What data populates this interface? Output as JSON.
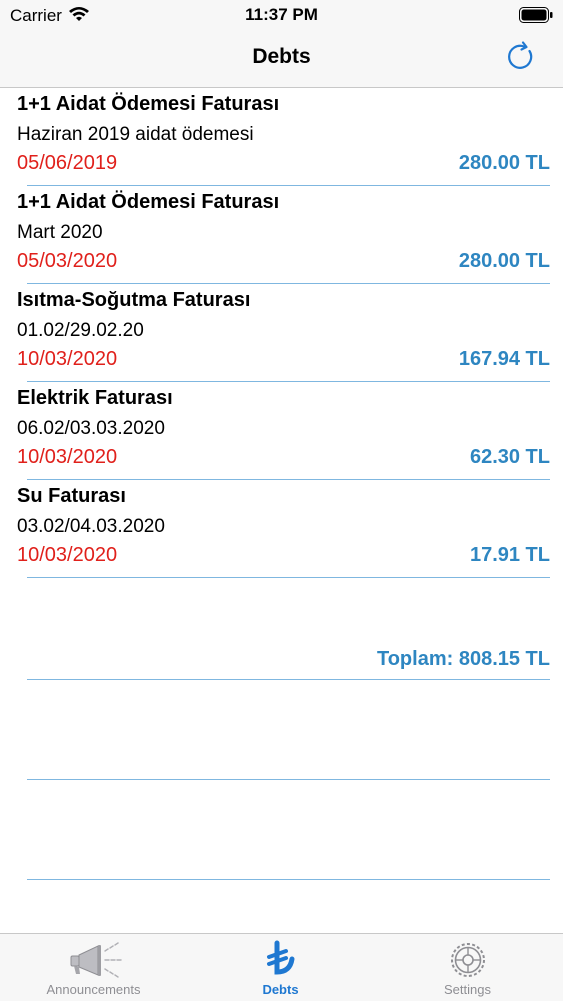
{
  "status_bar": {
    "carrier": "Carrier",
    "time": "11:37 PM"
  },
  "nav": {
    "title": "Debts",
    "refresh_icon": "refresh-icon"
  },
  "debts": [
    {
      "title": "1+1 Aidat Ödemesi Faturası",
      "subtitle": "Haziran 2019 aidat ödemesi",
      "date": "05/06/2019",
      "amount": "280.00 TL"
    },
    {
      "title": "1+1 Aidat Ödemesi Faturası",
      "subtitle": "Mart 2020",
      "date": "05/03/2020",
      "amount": "280.00 TL"
    },
    {
      "title": "Isıtma-Soğutma Faturası",
      "subtitle": "01.02/29.02.20",
      "date": "10/03/2020",
      "amount": "167.94 TL"
    },
    {
      "title": "Elektrik Faturası",
      "subtitle": "06.02/03.03.2020",
      "date": "10/03/2020",
      "amount": "62.30 TL"
    },
    {
      "title": "Su Faturası",
      "subtitle": "03.02/04.03.2020",
      "date": "10/03/2020",
      "amount": "17.91 TL"
    }
  ],
  "total": "Toplam: 808.15 TL",
  "tabs": [
    {
      "label": "Announcements",
      "icon": "megaphone-icon",
      "active": false
    },
    {
      "label": "Debts",
      "icon": "lira-icon",
      "active": true
    },
    {
      "label": "Settings",
      "icon": "gear-icon",
      "active": false
    }
  ],
  "colors": {
    "accent": "#1f78d1",
    "amount": "#2e86c1",
    "date": "#e0201b",
    "inactive": "#8e8e93"
  }
}
